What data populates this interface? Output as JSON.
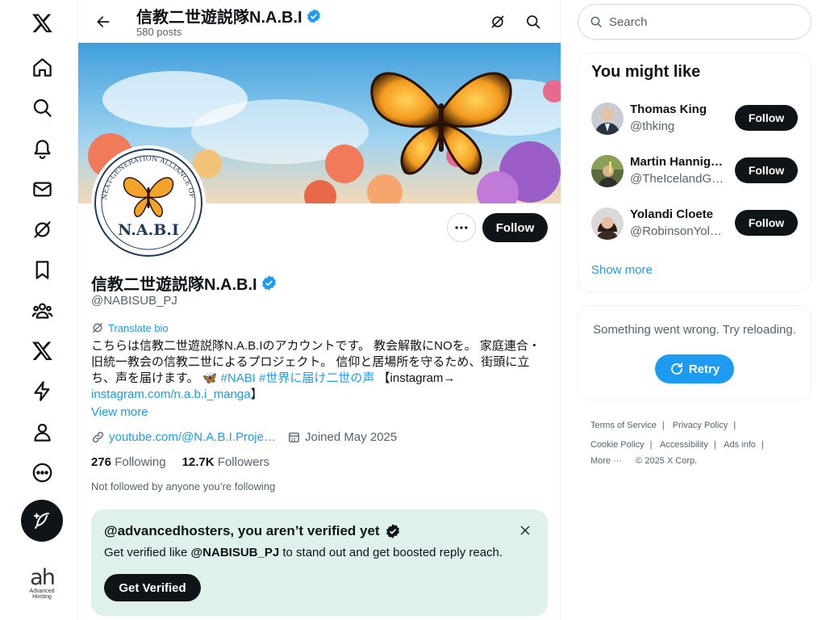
{
  "nav": {
    "items": [
      "x-logo",
      "home",
      "explore",
      "notifications",
      "messages",
      "grok",
      "bookmarks",
      "communities",
      "premium",
      "verified-orgs",
      "profile",
      "more"
    ]
  },
  "account": {
    "logo_text": "ah",
    "logo_sub": "Advanced Hosting"
  },
  "header": {
    "title": "信教二世遊説隊N.A.B.I",
    "posts": "580 posts"
  },
  "profile": {
    "name": "信教二世遊説隊N.A.B.I",
    "handle": "@NABISUB_PJ",
    "follow_label": "Follow",
    "translate_label": "Translate bio",
    "bio_line1": "こちらは信教二世遊説隊N.A.B.Iのアカウントです。 教会解散にNOを。 家庭連合・",
    "bio_line2": "旧統一教会の信教二世によるプロジェクト。 信仰と居場所を守るため、街頭に立",
    "bio_line3_pre": "ち、声を届けます。 🦋 ",
    "bio_tags": "#NABI #世界に届け二世の声",
    "bio_line3_post": " 【instagram→",
    "bio_link": "instagram.com/n.a.b.i_manga",
    "bio_link_post": "】",
    "view_more": "View more",
    "website": "youtube.com/@N.A.B.I.Proje…",
    "joined": "Joined May 2025",
    "following_count": "276",
    "following_label": "Following",
    "followers_count": "12.7K",
    "followers_label": "Followers",
    "not_followed": "Not followed by anyone you’re following",
    "avatar_ring_text": "NEXT-GENERATION ALLIANCE OF BELIEF AND INT",
    "avatar_text": "N.A.B.I"
  },
  "verify_card": {
    "title": "@advancedhosters, you aren’t verified yet",
    "text_pre": "Get verified like ",
    "text_handle": "@NABISUB_PJ",
    "text_post": " to stand out and get boosted reply reach.",
    "button": "Get Verified"
  },
  "search": {
    "placeholder": "Search"
  },
  "who_to_follow": {
    "title": "You might like",
    "users": [
      {
        "name": "Thomas King",
        "handle": "@thking",
        "button": "Follow"
      },
      {
        "name": "Martin Hannig…",
        "handle": "@TheIcelandG…",
        "button": "Follow"
      },
      {
        "name": "Yolandi Cloete",
        "handle": "@RobinsonYol…",
        "button": "Follow"
      }
    ],
    "show_more": "Show more"
  },
  "error_card": {
    "text": "Something went wrong. Try reloading.",
    "retry": "Retry"
  },
  "footer": {
    "links": [
      "Terms of Service",
      "Privacy Policy",
      "Cookie Policy",
      "Accessibility",
      "Ads info",
      "More ···"
    ],
    "copyright": "© 2025 X Corp."
  },
  "colors": {
    "accent": "#1d9bf0",
    "text": "#0f1419",
    "muted": "#536471",
    "verify_bg": "#def1eb"
  }
}
